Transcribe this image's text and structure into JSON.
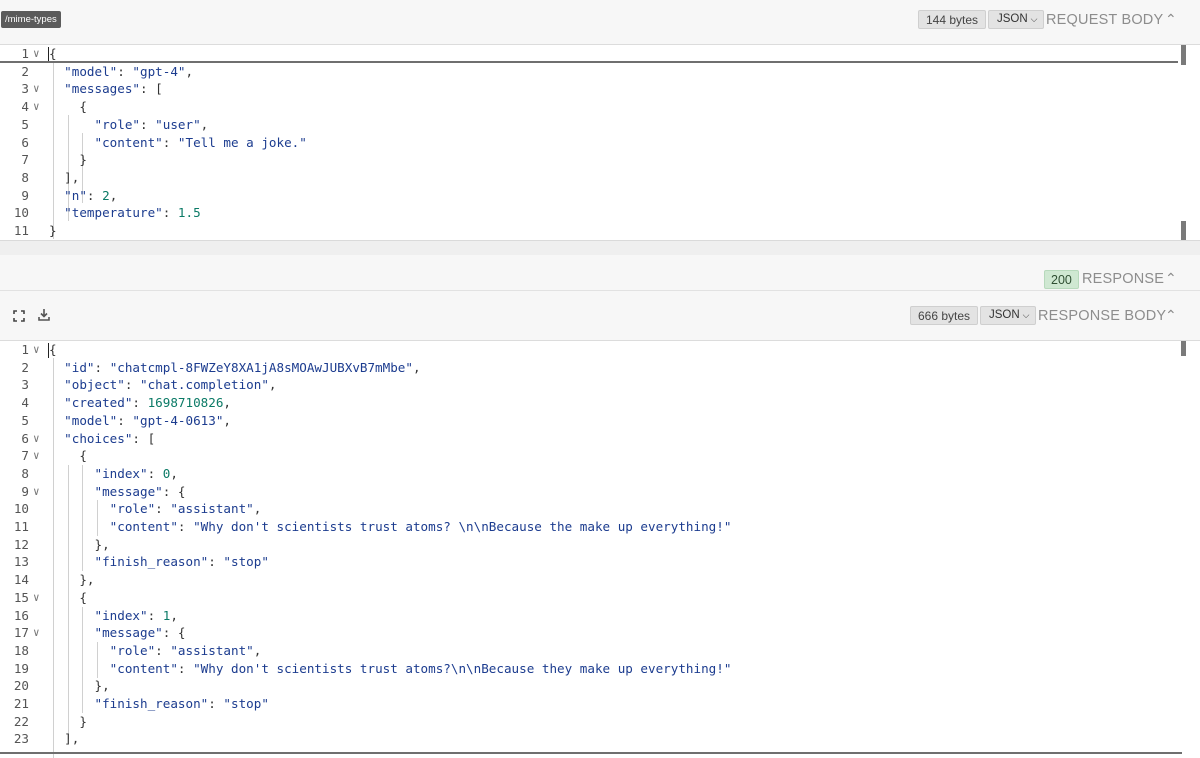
{
  "request": {
    "path": "/mime-types",
    "bytes": "144 bytes",
    "format": "JSON",
    "title": "REQUEST BODY",
    "lines": [
      {
        "num": "1"
      },
      {
        "num": "2"
      },
      {
        "num": "3"
      },
      {
        "num": "4"
      },
      {
        "num": "5"
      },
      {
        "num": "6"
      },
      {
        "num": "7"
      },
      {
        "num": "8"
      },
      {
        "num": "9"
      },
      {
        "num": "10"
      },
      {
        "num": "11"
      }
    ]
  },
  "response": {
    "status_code": "200",
    "status_label": "RESPONSE",
    "bytes": "666 bytes",
    "format": "JSON",
    "title": "RESPONSE BODY",
    "icons": {
      "expand": "fullscreen-icon",
      "download": "download-icon"
    },
    "lines": [
      {
        "num": "1"
      },
      {
        "num": "2"
      },
      {
        "num": "3"
      },
      {
        "num": "4"
      },
      {
        "num": "5"
      },
      {
        "num": "6"
      },
      {
        "num": "7"
      },
      {
        "num": "8"
      },
      {
        "num": "9"
      },
      {
        "num": "10"
      },
      {
        "num": "11"
      },
      {
        "num": "12"
      },
      {
        "num": "13"
      },
      {
        "num": "14"
      },
      {
        "num": "15"
      },
      {
        "num": "16"
      },
      {
        "num": "17"
      },
      {
        "num": "18"
      },
      {
        "num": "19"
      },
      {
        "num": "20"
      },
      {
        "num": "21"
      },
      {
        "num": "22"
      },
      {
        "num": "23"
      }
    ]
  },
  "request_json": {
    "model_key": "\"model\"",
    "model_val": "\"gpt-4\"",
    "messages_key": "\"messages\"",
    "role_key": "\"role\"",
    "role_val": "\"user\"",
    "content_key": "\"content\"",
    "content_val": "\"Tell me a joke.\"",
    "n_key": "\"n\"",
    "n_val": "2",
    "temp_key": "\"temperature\"",
    "temp_val": "1.5"
  },
  "response_json": {
    "id_key": "\"id\"",
    "id_val": "\"chatcmpl-8FWZeY8XA1jA8sMOAwJUBXvB7mMbe\"",
    "object_key": "\"object\"",
    "object_val": "\"chat.completion\"",
    "created_key": "\"created\"",
    "created_val": "1698710826",
    "model_key": "\"model\"",
    "model_val": "\"gpt-4-0613\"",
    "choices_key": "\"choices\"",
    "index_key": "\"index\"",
    "index0_val": "0",
    "index1_val": "1",
    "message_key": "\"message\"",
    "role_key": "\"role\"",
    "role_val": "\"assistant\"",
    "content_key": "\"content\"",
    "content0_val": "\"Why don't scientists trust atoms? \\n\\nBecause the make up everything!\"",
    "content1_val": "\"Why don't scientists trust atoms?\\n\\nBecause they make up everything!\"",
    "finish_key": "\"finish_reason\"",
    "finish_val": "\"stop\""
  }
}
